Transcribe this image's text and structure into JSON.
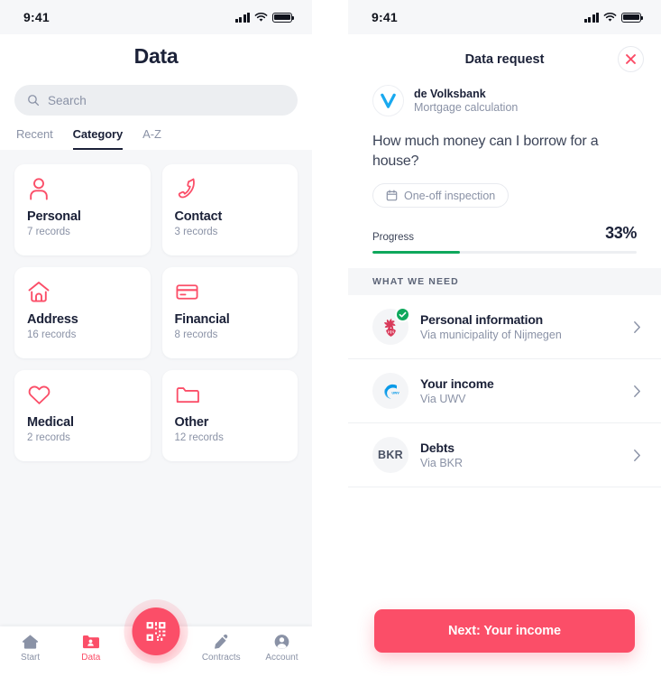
{
  "colors": {
    "accent_pink": "#fb4e68",
    "navy_text": "#1b2138",
    "muted_text": "#8a92a6",
    "progress_green": "#0fa85c",
    "volksbank_blue": "#19a9ef",
    "uwv_blue": "#0a9ae8",
    "crest_red": "#d6294c",
    "panel_bg": "#f6f7f9"
  },
  "left_screen": {
    "status_bar": {
      "time": "9:41",
      "icons": [
        "signal-bars-icon",
        "wifi-icon",
        "battery-icon"
      ]
    },
    "page_title": "Data",
    "search": {
      "placeholder": "Search",
      "icon": "search-icon"
    },
    "tabs": [
      {
        "label": "Recent",
        "active": false
      },
      {
        "label": "Category",
        "active": true
      },
      {
        "label": "A-Z",
        "active": false
      }
    ],
    "categories": [
      {
        "name": "Personal",
        "records": "7 records",
        "icon": "person-icon"
      },
      {
        "name": "Contact",
        "records": "3 records",
        "icon": "phone-icon"
      },
      {
        "name": "Address",
        "records": "16 records",
        "icon": "home-icon"
      },
      {
        "name": "Financial",
        "records": "8 records",
        "icon": "credit-card-icon"
      },
      {
        "name": "Medical",
        "records": "2 records",
        "icon": "heart-icon"
      },
      {
        "name": "Other",
        "records": "12 records",
        "icon": "folder-icon"
      }
    ],
    "tab_bar": {
      "items": [
        {
          "label": "Start",
          "icon": "home-icon",
          "active": false
        },
        {
          "label": "Data",
          "icon": "folder-user-icon",
          "active": true
        },
        {
          "label": "Contracts",
          "icon": "pen-icon",
          "active": false
        },
        {
          "label": "Account",
          "icon": "account-icon",
          "active": false
        }
      ],
      "fab": {
        "icon": "qr-code-icon",
        "label": "Scan QR code"
      }
    }
  },
  "right_screen": {
    "status_bar": {
      "time": "9:41",
      "icons": [
        "signal-bars-icon",
        "wifi-icon",
        "battery-icon"
      ]
    },
    "sheet_title": "Data request",
    "close_icon": "close-icon",
    "organisation": {
      "name": "de Volksbank",
      "subtitle": "Mortgage calculation",
      "logo": "volksbank-v-logo"
    },
    "question": "How much money can I borrow for a house?",
    "chip": {
      "label": "One-off inspection",
      "icon": "calendar-icon"
    },
    "progress": {
      "label": "Progress",
      "percent_label": "33%",
      "percent_value": 33
    },
    "section_header": "WHAT WE NEED",
    "needs": [
      {
        "title": "Personal information",
        "source": "Via municipality of Nijmegen",
        "logo": "nijmegen-crest-logo",
        "completed": true,
        "chevron": "chevron-right-icon"
      },
      {
        "title": "Your income",
        "source": "Via UWV",
        "logo": "uwv-logo",
        "completed": false,
        "chevron": "chevron-right-icon"
      },
      {
        "title": "Debts",
        "source": "Via BKR",
        "logo": "bkr-logo",
        "logo_text": "BKR",
        "completed": false,
        "chevron": "chevron-right-icon"
      }
    ],
    "cta_label": "Next: Your income"
  }
}
